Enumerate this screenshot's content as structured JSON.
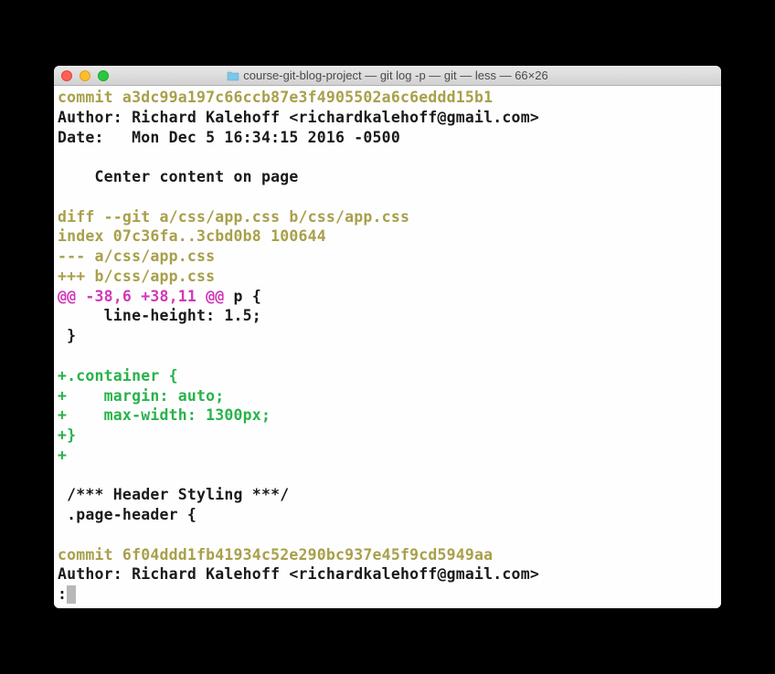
{
  "titlebar": {
    "title": "course-git-blog-project — git log -p — git — less — 66×26"
  },
  "terminal": {
    "lines": [
      {
        "cls": "yellow",
        "text": "commit a3dc99a197c66ccb87e3f4905502a6c6eddd15b1"
      },
      {
        "cls": "normal",
        "text": "Author: Richard Kalehoff <richardkalehoff@gmail.com>"
      },
      {
        "cls": "normal",
        "text": "Date:   Mon Dec 5 16:34:15 2016 -0500"
      },
      {
        "cls": "normal",
        "text": ""
      },
      {
        "cls": "normal",
        "text": "    Center content on page"
      },
      {
        "cls": "normal",
        "text": ""
      },
      {
        "cls": "yellow",
        "text": "diff --git a/css/app.css b/css/app.css"
      },
      {
        "cls": "yellow",
        "text": "index 07c36fa..3cbd0b8 100644"
      },
      {
        "cls": "yellow",
        "text": "--- a/css/app.css"
      },
      {
        "cls": "yellow",
        "text": "+++ b/css/app.css"
      },
      {
        "cls": "hunk",
        "prefix": "@@ -38,6 +38,11 @@",
        "suffix": " p {"
      },
      {
        "cls": "normal",
        "text": "     line-height: 1.5;"
      },
      {
        "cls": "normal",
        "text": " }"
      },
      {
        "cls": "normal",
        "text": ""
      },
      {
        "cls": "green",
        "text": "+.container {"
      },
      {
        "cls": "green",
        "text": "+    margin: auto;"
      },
      {
        "cls": "green",
        "text": "+    max-width: 1300px;"
      },
      {
        "cls": "green",
        "text": "+}"
      },
      {
        "cls": "green",
        "text": "+"
      },
      {
        "cls": "normal",
        "text": ""
      },
      {
        "cls": "normal",
        "text": " /*** Header Styling ***/"
      },
      {
        "cls": "normal",
        "text": " .page-header {"
      },
      {
        "cls": "normal",
        "text": ""
      },
      {
        "cls": "yellow",
        "text": "commit 6f04ddd1fb41934c52e290bc937e45f9cd5949aa"
      },
      {
        "cls": "normal",
        "text": "Author: Richard Kalehoff <richardkalehoff@gmail.com>"
      }
    ],
    "prompt": ":"
  }
}
